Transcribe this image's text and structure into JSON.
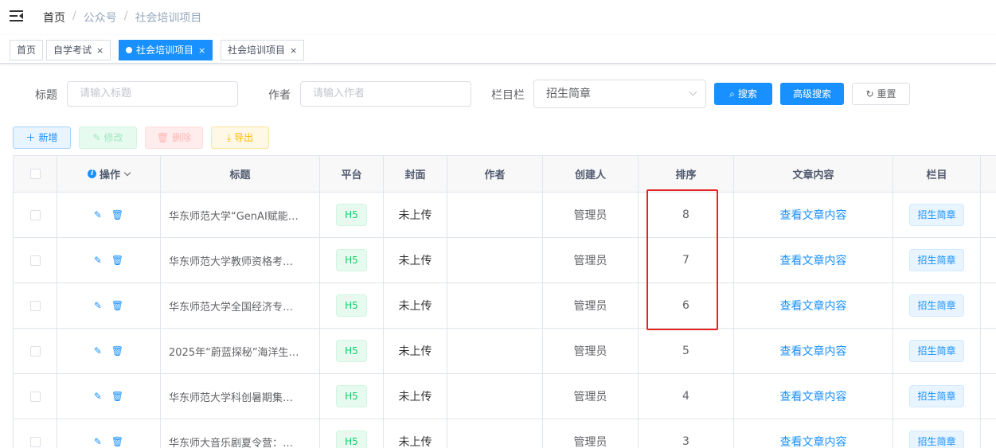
{
  "breadcrumb": [
    "首页",
    "公众号",
    "社会培训项目"
  ],
  "tabs": [
    {
      "label": "首页",
      "active": false,
      "closable": false
    },
    {
      "label": "自学考试",
      "active": false,
      "closable": true
    },
    {
      "label": "社会培训项目",
      "active": true,
      "closable": true
    },
    {
      "label": "社会培训项目",
      "active": false,
      "closable": true
    }
  ],
  "search": {
    "title_label": "标题",
    "title_placeholder": "请输入标题",
    "author_label": "作者",
    "author_placeholder": "请输入作者",
    "column_label": "栏目栏",
    "column_value": "招生简章",
    "search_btn": "搜索",
    "advanced_btn": "高级搜索",
    "reset_btn": "重置"
  },
  "toolbar": {
    "add": "新增",
    "edit": "修改",
    "delete": "删除",
    "export": "导出"
  },
  "table": {
    "headers": [
      "操作",
      "标题",
      "平台",
      "封面",
      "作者",
      "创建人",
      "排序",
      "文章内容",
      "栏目"
    ],
    "rows": [
      {
        "title": "华东师范大学“GenAI赋能…",
        "platform": "H5",
        "cover": "未上传",
        "author": "",
        "creator": "管理员",
        "sort": "8",
        "content": "查看文章内容",
        "column": "招生简章"
      },
      {
        "title": "华东师范大学教师资格考…",
        "platform": "H5",
        "cover": "未上传",
        "author": "",
        "creator": "管理员",
        "sort": "7",
        "content": "查看文章内容",
        "column": "招生简章"
      },
      {
        "title": "华东师范大学全国经济专…",
        "platform": "H5",
        "cover": "未上传",
        "author": "",
        "creator": "管理员",
        "sort": "6",
        "content": "查看文章内容",
        "column": "招生简章"
      },
      {
        "title": "2025年“蔚蓝探秘”海洋生…",
        "platform": "H5",
        "cover": "未上传",
        "author": "",
        "creator": "管理员",
        "sort": "5",
        "content": "查看文章内容",
        "column": "招生简章"
      },
      {
        "title": "华东师范大学科创暑期集…",
        "platform": "H5",
        "cover": "未上传",
        "author": "",
        "creator": "管理员",
        "sort": "4",
        "content": "查看文章内容",
        "column": "招生简章"
      },
      {
        "title": "华东师大音乐剧夏令营：…",
        "platform": "H5",
        "cover": "未上传",
        "author": "",
        "creator": "管理员",
        "sort": "3",
        "content": "查看文章内容",
        "column": "招生简章"
      }
    ]
  }
}
